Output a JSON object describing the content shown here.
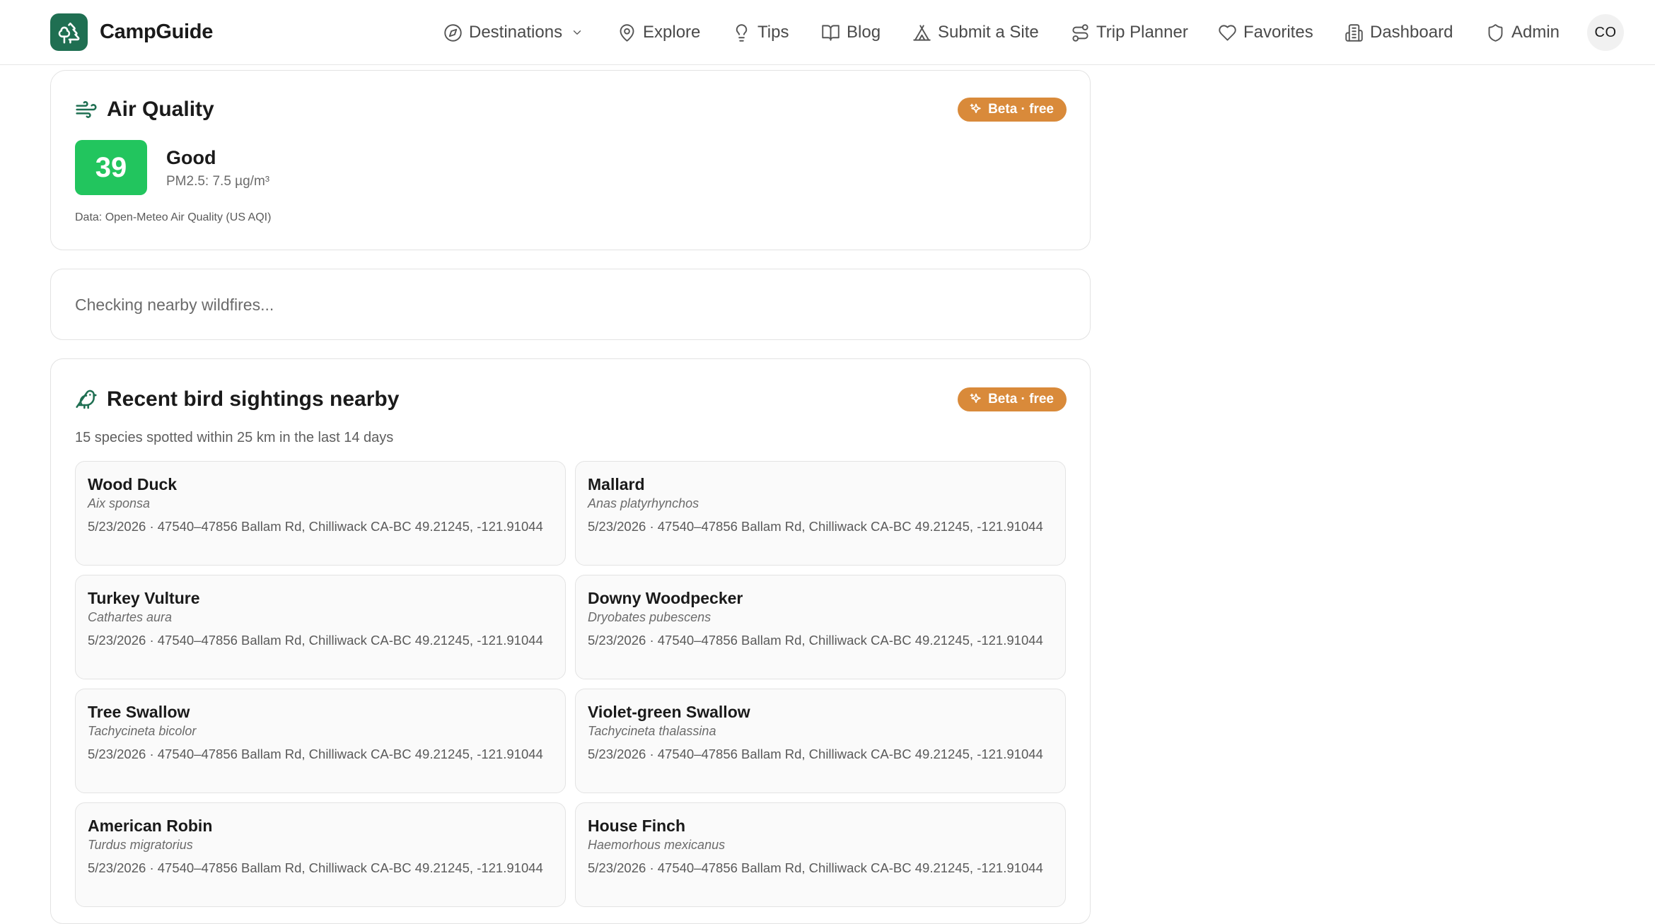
{
  "brand": {
    "name": "CampGuide"
  },
  "nav": {
    "items": [
      {
        "label": "Destinations",
        "icon": "compass-icon"
      },
      {
        "label": "Explore",
        "icon": "map-pin-icon"
      },
      {
        "label": "Tips",
        "icon": "lightbulb-icon"
      },
      {
        "label": "Blog",
        "icon": "book-icon"
      },
      {
        "label": "Submit a Site",
        "icon": "tent-icon"
      },
      {
        "label": "Trip Planner",
        "icon": "route-icon"
      },
      {
        "label": "Favorites",
        "icon": "heart-icon"
      },
      {
        "label": "Dashboard",
        "icon": "building-icon"
      },
      {
        "label": "Admin",
        "icon": "shield-icon"
      }
    ],
    "avatar_initials": "CO"
  },
  "air_quality": {
    "title": "Air Quality",
    "badge": "Beta · free",
    "aqi": "39",
    "category": "Good",
    "pm25": "PM2.5: 7.5 µg/m³",
    "source": "Data: Open-Meteo Air Quality (US AQI)",
    "aqi_color": "#22c55e"
  },
  "wildfire": {
    "status": "Checking nearby wildfires..."
  },
  "birds": {
    "title": "Recent bird sightings nearby",
    "badge": "Beta · free",
    "subtitle": "15 species spotted within 25 km in the last 14 days",
    "sightings": [
      {
        "name": "Wood Duck",
        "scientific": "Aix sponsa",
        "location": "5/23/2026 · 47540–47856 Ballam Rd, Chilliwack CA-BC 49.21245, -121.91044"
      },
      {
        "name": "Mallard",
        "scientific": "Anas platyrhynchos",
        "location": "5/23/2026 · 47540–47856 Ballam Rd, Chilliwack CA-BC 49.21245, -121.91044"
      },
      {
        "name": "Turkey Vulture",
        "scientific": "Cathartes aura",
        "location": "5/23/2026 · 47540–47856 Ballam Rd, Chilliwack CA-BC 49.21245, -121.91044"
      },
      {
        "name": "Downy Woodpecker",
        "scientific": "Dryobates pubescens",
        "location": "5/23/2026 · 47540–47856 Ballam Rd, Chilliwack CA-BC 49.21245, -121.91044"
      },
      {
        "name": "Tree Swallow",
        "scientific": "Tachycineta bicolor",
        "location": "5/23/2026 · 47540–47856 Ballam Rd, Chilliwack CA-BC 49.21245, -121.91044"
      },
      {
        "name": "Violet-green Swallow",
        "scientific": "Tachycineta thalassina",
        "location": "5/23/2026 · 47540–47856 Ballam Rd, Chilliwack CA-BC 49.21245, -121.91044"
      },
      {
        "name": "American Robin",
        "scientific": "Turdus migratorius",
        "location": "5/23/2026 · 47540–47856 Ballam Rd, Chilliwack CA-BC 49.21245, -121.91044"
      },
      {
        "name": "House Finch",
        "scientific": "Haemorhous mexicanus",
        "location": "5/23/2026 · 47540–47856 Ballam Rd, Chilliwack CA-BC 49.21245, -121.91044"
      }
    ]
  },
  "colors": {
    "brand_green": "#1f6f52",
    "beta_orange": "#d98a3a"
  }
}
